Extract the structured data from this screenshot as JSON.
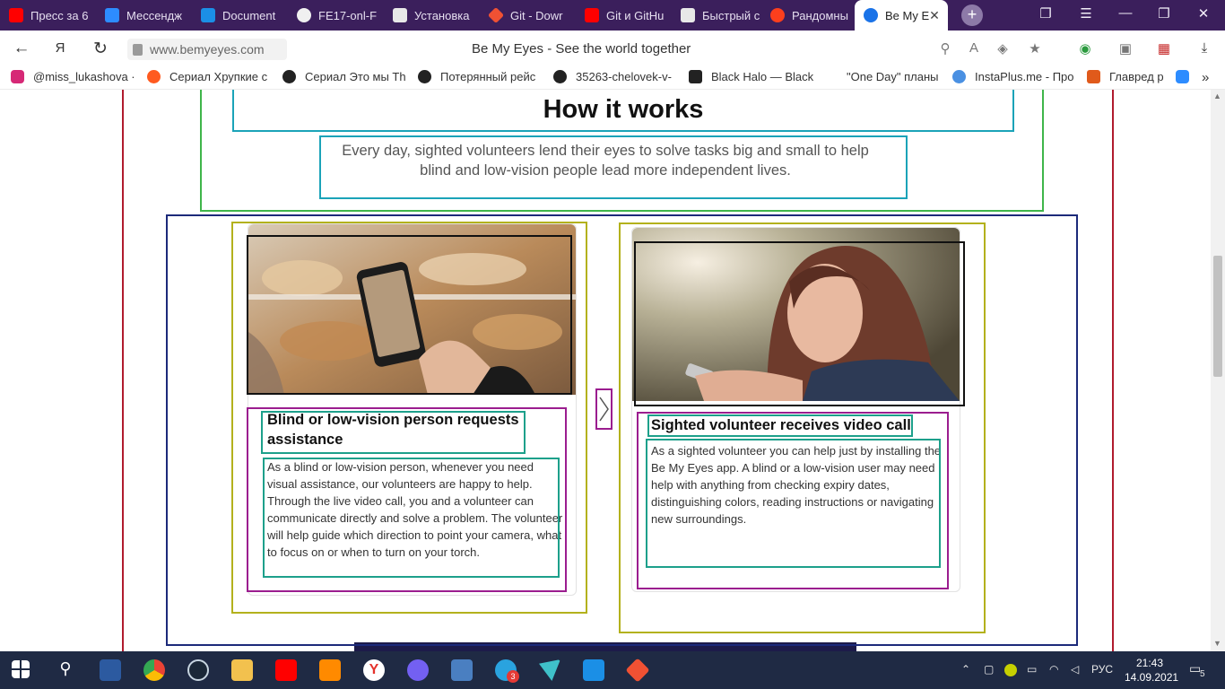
{
  "browser": {
    "tabs": [
      {
        "label": "Пресс за 6",
        "icon": "youtube-icon",
        "color": "#ff0000"
      },
      {
        "label": "Мессендж",
        "icon": "messenger-icon",
        "color": "#2d8cff"
      },
      {
        "label": "Document",
        "icon": "vscode-icon",
        "color": "#1b8fe6"
      },
      {
        "label": "FE17-onl-F",
        "icon": "github-icon",
        "color": "#f0f0f0"
      },
      {
        "label": "Установка",
        "icon": "habr-icon",
        "color": "#e8e8e8"
      },
      {
        "label": "Git - Dowr",
        "icon": "git-icon",
        "color": "#f05133"
      },
      {
        "label": "Git и GitHu",
        "icon": "youtube-icon",
        "color": "#ff0000"
      },
      {
        "label": "Быстрый с",
        "icon": "doc-icon",
        "color": "#e8e8e8"
      },
      {
        "label": "Рандомны",
        "icon": "yandex-icon",
        "color": "#fc3f1d"
      },
      {
        "label": "Be My E",
        "icon": "bemyeyes-icon",
        "color": "#1a73e8",
        "active": true
      }
    ],
    "new_tab": "+",
    "url": "www.bemyeyes.com",
    "page_title": "Be My Eyes - See the world together",
    "bookmarks": [
      {
        "label": "@miss_lukashova ·",
        "icon": "instagram-icon",
        "color": "#d62976"
      },
      {
        "label": "Сериал Хрупкие с",
        "icon": "bookmark-icon",
        "color": "#ff5a1f"
      },
      {
        "label": "Сериал Это мы Th",
        "icon": "bookmark-icon",
        "color": "#222"
      },
      {
        "label": "Потерянный рейс",
        "icon": "bookmark-icon",
        "color": "#222"
      },
      {
        "label": "35263-chelovek-v-",
        "icon": "bookmark-icon",
        "color": "#222"
      },
      {
        "label": "Black Halo — Black",
        "icon": "pause-icon",
        "color": "#222"
      },
      {
        "label": "\"One Day\" планы",
        "icon": "",
        "color": "#fff"
      },
      {
        "label": "InstaPlus.me - Про",
        "icon": "instaplus-icon",
        "color": "#4a90e2"
      },
      {
        "label": "Главред р",
        "icon": "glavred-icon",
        "color": "#e05a1b"
      }
    ]
  },
  "page": {
    "title": "How it works",
    "subtitle": "Every day, sighted volunteers lend their eyes to solve tasks big and small to help blind and low-vision people lead more independent lives.",
    "cards": [
      {
        "title": "Blind or low-vision person requests assistance",
        "text": "As a blind or low-vision person, whenever you need visual assistance, our volunteers are happy to help. Through the live video call, you and a volunteer can communicate directly and solve a problem. The volunteer will help guide which direction to point your camera, what to focus on or when to turn on your torch."
      },
      {
        "title": "Sighted volunteer receives video call",
        "text": "As a sighted volunteer you can help just by installing the Be My Eyes app. A blind or a low-vision user may need help with anything from checking expiry dates, distinguishing colors, reading instructions or navigating new surroundings."
      }
    ]
  },
  "taskbar": {
    "language": "РУС",
    "time": "21:43",
    "date": "14.09.2021",
    "notifications": "5",
    "telegram_badge": "3"
  }
}
